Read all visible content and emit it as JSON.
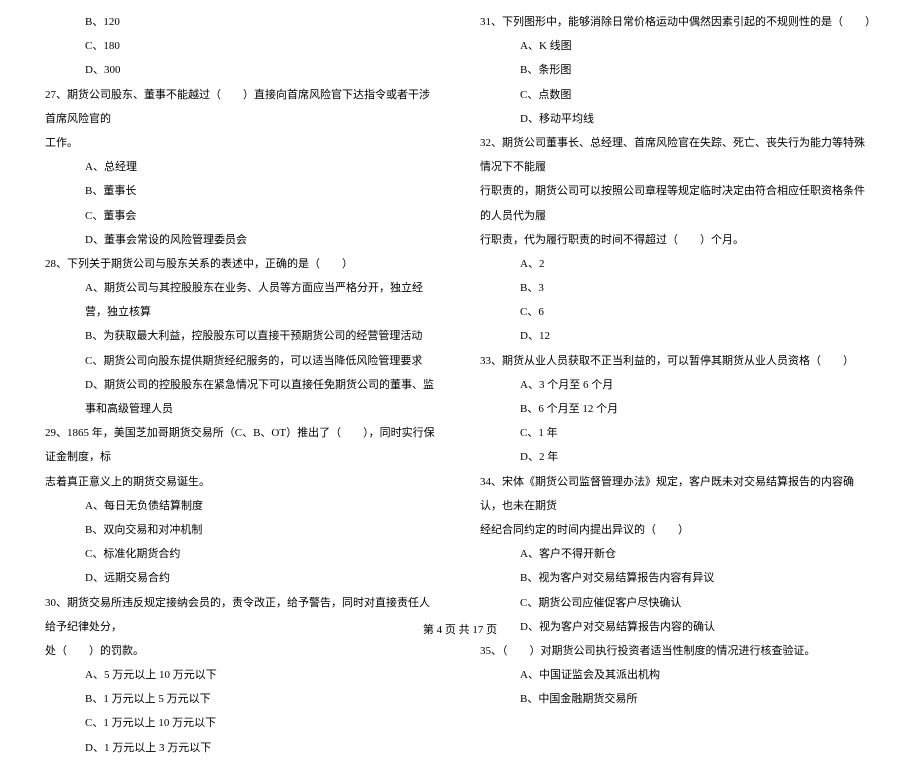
{
  "left": {
    "opt_b_120": "B、120",
    "opt_c_180": "C、180",
    "opt_d_300": "D、300",
    "q27": "27、期货公司股东、董事不能越过（　　）直接向首席风险官下达指令或者干涉首席风险官的",
    "q27_cont": "工作。",
    "q27_a": "A、总经理",
    "q27_b": "B、董事长",
    "q27_c": "C、董事会",
    "q27_d": "D、董事会常设的风险管理委员会",
    "q28": "28、下列关于期货公司与股东关系的表述中，正确的是（　　）",
    "q28_a": "A、期货公司与其控股股东在业务、人员等方面应当严格分开，独立经营，独立核算",
    "q28_b": "B、为获取最大利益，控股股东可以直接干预期货公司的经营管理活动",
    "q28_c": "C、期货公司向股东提供期货经纪服务的，可以适当降低风险管理要求",
    "q28_d": "D、期货公司的控股股东在紧急情况下可以直接任免期货公司的董事、监事和高级管理人员",
    "q29": "29、1865 年，美国芝加哥期货交易所（C、B、OT）推出了（　　），同时实行保证金制度，标",
    "q29_cont": "志着真正意义上的期货交易诞生。",
    "q29_a": "A、每日无负债结算制度",
    "q29_b": "B、双向交易和对冲机制",
    "q29_c": "C、标准化期货合约",
    "q29_d": "D、远期交易合约",
    "q30": "30、期货交易所违反规定接纳会员的，责令改正，给予警告，同时对直接责任人给予纪律处分，",
    "q30_cont": "处（　　）的罚款。",
    "q30_a": "A、5 万元以上 10 万元以下",
    "q30_b": "B、1 万元以上 5 万元以下",
    "q30_c": "C、1 万元以上 10 万元以下",
    "q30_d": "D、1 万元以上 3 万元以下"
  },
  "right": {
    "q31": "31、下列图形中，能够消除日常价格运动中偶然因素引起的不规则性的是（　　）",
    "q31_a": "A、K 线图",
    "q31_b": "B、条形图",
    "q31_c": "C、点数图",
    "q31_d": "D、移动平均线",
    "q32": "32、期货公司董事长、总经理、首席风险官在失踪、死亡、丧失行为能力等特殊情况下不能履",
    "q32_cont1": "行职责的，期货公司可以按照公司章程等规定临时决定由符合相应任职资格条件的人员代为履",
    "q32_cont2": "行职责，代为履行职责的时间不得超过（　　）个月。",
    "q32_a": "A、2",
    "q32_b": "B、3",
    "q32_c": "C、6",
    "q32_d": "D、12",
    "q33": "33、期货从业人员获取不正当利益的，可以暂停其期货从业人员资格（　　）",
    "q33_a": "A、3 个月至 6 个月",
    "q33_b": "B、6 个月至 12 个月",
    "q33_c": "C、1 年",
    "q33_d": "D、2 年",
    "q34": "34、宋体《期货公司监督管理办法》规定，客户既未对交易结算报告的内容确认，也未在期货",
    "q34_cont": "经纪合同约定的时间内提出异议的（　　）",
    "q34_a": "A、客户不得开新仓",
    "q34_b": "B、视为客户对交易结算报告内容有异议",
    "q34_c": "C、期货公司应催促客户尽快确认",
    "q34_d": "D、视为客户对交易结算报告内容的确认",
    "q35": "35、（　　）对期货公司执行投资者适当性制度的情况进行核查验证。",
    "q35_a": "A、中国证监会及其派出机构",
    "q35_b": "B、中国金融期货交易所"
  },
  "footer": "第 4 页 共 17 页"
}
